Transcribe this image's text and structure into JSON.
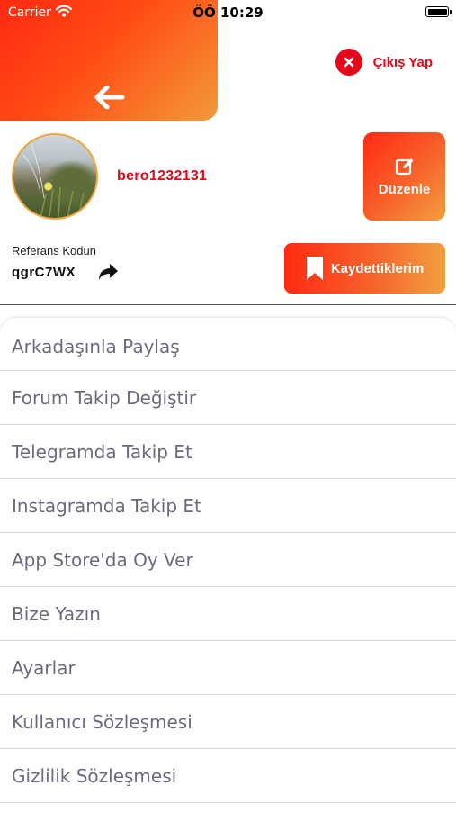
{
  "status_bar": {
    "carrier": "Carrier",
    "time": "ÖÖ 10:29"
  },
  "header": {
    "logout_label": "Çıkış Yap"
  },
  "profile": {
    "username": "bero1232131",
    "edit_label": "Düzenle",
    "referral_label": "Referans Kodun",
    "referral_code": "qgrC7WX",
    "saved_label": "Kaydettiklerim"
  },
  "menu": {
    "items": [
      {
        "label": "Arkadaşınla Paylaş"
      },
      {
        "label": "Forum Takip Değiştir"
      },
      {
        "label": "Telegramda Takip Et"
      },
      {
        "label": "Instagramda Takip Et"
      },
      {
        "label": "App Store'da Oy Ver"
      },
      {
        "label": "Bize Yazın"
      },
      {
        "label": "Ayarlar"
      },
      {
        "label": "Kullanıcı Sözleşmesi"
      },
      {
        "label": "Gizlilik Sözleşmesi"
      }
    ]
  },
  "colors": {
    "brand_red": "#e5071a",
    "gradient_start": "#ff2a12",
    "gradient_end": "#f2a03e",
    "menu_text": "#6b6b80"
  },
  "icons": [
    "wifi-icon",
    "battery-icon",
    "back-arrow-icon",
    "close-icon",
    "edit-icon",
    "share-arrow-icon",
    "bookmark-icon"
  ]
}
